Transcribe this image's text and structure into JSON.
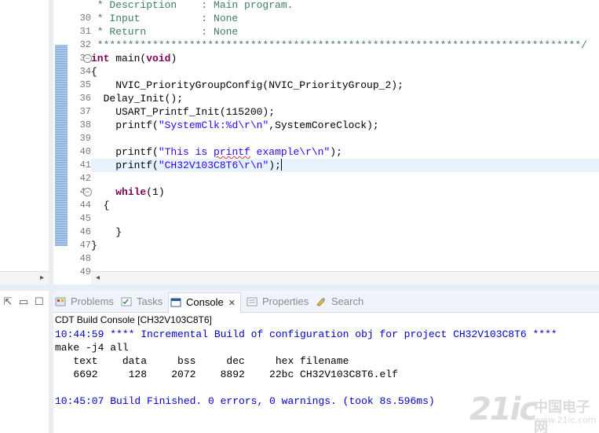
{
  "editor": {
    "lines": [
      {
        "num": "",
        "parts": [
          {
            "t": " * Description    : Main program.",
            "c": "c-comment"
          }
        ]
      },
      {
        "num": "30",
        "parts": [
          {
            "t": " * Input          : None",
            "c": "c-comment"
          }
        ]
      },
      {
        "num": "31",
        "parts": [
          {
            "t": " * Return         : None",
            "c": "c-comment"
          }
        ]
      },
      {
        "num": "32",
        "parts": [
          {
            "t": " *******************************************************************************/",
            "c": "c-comment"
          }
        ]
      },
      {
        "num": "33",
        "fold": "−",
        "parts": [
          {
            "t": "int",
            "c": "c-kw"
          },
          {
            "t": " main(",
            "c": ""
          },
          {
            "t": "void",
            "c": "c-kw"
          },
          {
            "t": ")",
            "c": ""
          }
        ]
      },
      {
        "num": "34",
        "parts": [
          {
            "t": "{",
            "c": ""
          }
        ]
      },
      {
        "num": "35",
        "parts": [
          {
            "t": "    NVIC_PriorityGroupConfig(NVIC_PriorityGroup_2);",
            "c": ""
          }
        ]
      },
      {
        "num": "36",
        "parts": [
          {
            "t": "  Delay_Init();",
            "c": ""
          }
        ]
      },
      {
        "num": "37",
        "parts": [
          {
            "t": "    USART_Printf_Init(115200);",
            "c": ""
          }
        ]
      },
      {
        "num": "38",
        "parts": [
          {
            "t": "    printf(",
            "c": ""
          },
          {
            "t": "\"SystemClk:%d\\r\\n\"",
            "c": "c-str"
          },
          {
            "t": ",SystemCoreClock);",
            "c": ""
          }
        ]
      },
      {
        "num": "39",
        "parts": [
          {
            "t": "",
            "c": ""
          }
        ]
      },
      {
        "num": "40",
        "parts": [
          {
            "t": "    printf(",
            "c": ""
          },
          {
            "t": "\"This is ",
            "c": "c-str"
          },
          {
            "t": "printf",
            "c": "c-str squiggle"
          },
          {
            "t": " example\\r\\n\"",
            "c": "c-str"
          },
          {
            "t": ");",
            "c": ""
          }
        ]
      },
      {
        "num": "41",
        "current": true,
        "parts": [
          {
            "t": "    printf(",
            "c": ""
          },
          {
            "t": "\"CH32V103C8T6\\r\\n\"",
            "c": "c-str"
          },
          {
            "t": ");",
            "c": ""
          }
        ]
      },
      {
        "num": "42",
        "parts": [
          {
            "t": "",
            "c": ""
          }
        ]
      },
      {
        "num": "43",
        "fold": "−",
        "parts": [
          {
            "t": "    ",
            "c": ""
          },
          {
            "t": "while",
            "c": "c-kw"
          },
          {
            "t": "(1)",
            "c": ""
          }
        ]
      },
      {
        "num": "44",
        "parts": [
          {
            "t": "  {",
            "c": ""
          }
        ]
      },
      {
        "num": "45",
        "parts": [
          {
            "t": "",
            "c": ""
          }
        ]
      },
      {
        "num": "46",
        "parts": [
          {
            "t": "    }",
            "c": ""
          }
        ]
      },
      {
        "num": "47",
        "parts": [
          {
            "t": "}",
            "c": ""
          }
        ]
      },
      {
        "num": "48",
        "parts": [
          {
            "t": "",
            "c": ""
          }
        ]
      },
      {
        "num": "49",
        "parts": [
          {
            "t": "",
            "c": ""
          }
        ]
      }
    ]
  },
  "panel": {
    "tabs": [
      {
        "label": "Problems",
        "icon": "problems-icon",
        "active": false
      },
      {
        "label": "Tasks",
        "icon": "tasks-icon",
        "active": false
      },
      {
        "label": "Console",
        "icon": "console-icon",
        "active": true
      },
      {
        "label": "Properties",
        "icon": "properties-icon",
        "active": false
      },
      {
        "label": "Search",
        "icon": "search-icon",
        "active": false
      }
    ],
    "console_title": "CDT Build Console [CH32V103C8T6]",
    "console_lines": [
      {
        "text": "10:44:59 **** Incremental Build of configuration obj for project CH32V103C8T6 ****",
        "color": "blue"
      },
      {
        "text": "make -j4 all",
        "color": "black"
      },
      {
        "text": "   text    data     bss     dec     hex filename",
        "color": "black"
      },
      {
        "text": "   6692     128    2072    8892    22bc CH32V103C8T6.elf",
        "color": "black"
      },
      {
        "text": "",
        "color": "black"
      },
      {
        "text": "10:45:07 Build Finished. 0 errors, 0 warnings. (took 8s.596ms)",
        "color": "blue"
      }
    ]
  },
  "watermark": {
    "big": "21ic",
    "small": "中国电子网",
    "url": "www.21ic.com"
  }
}
